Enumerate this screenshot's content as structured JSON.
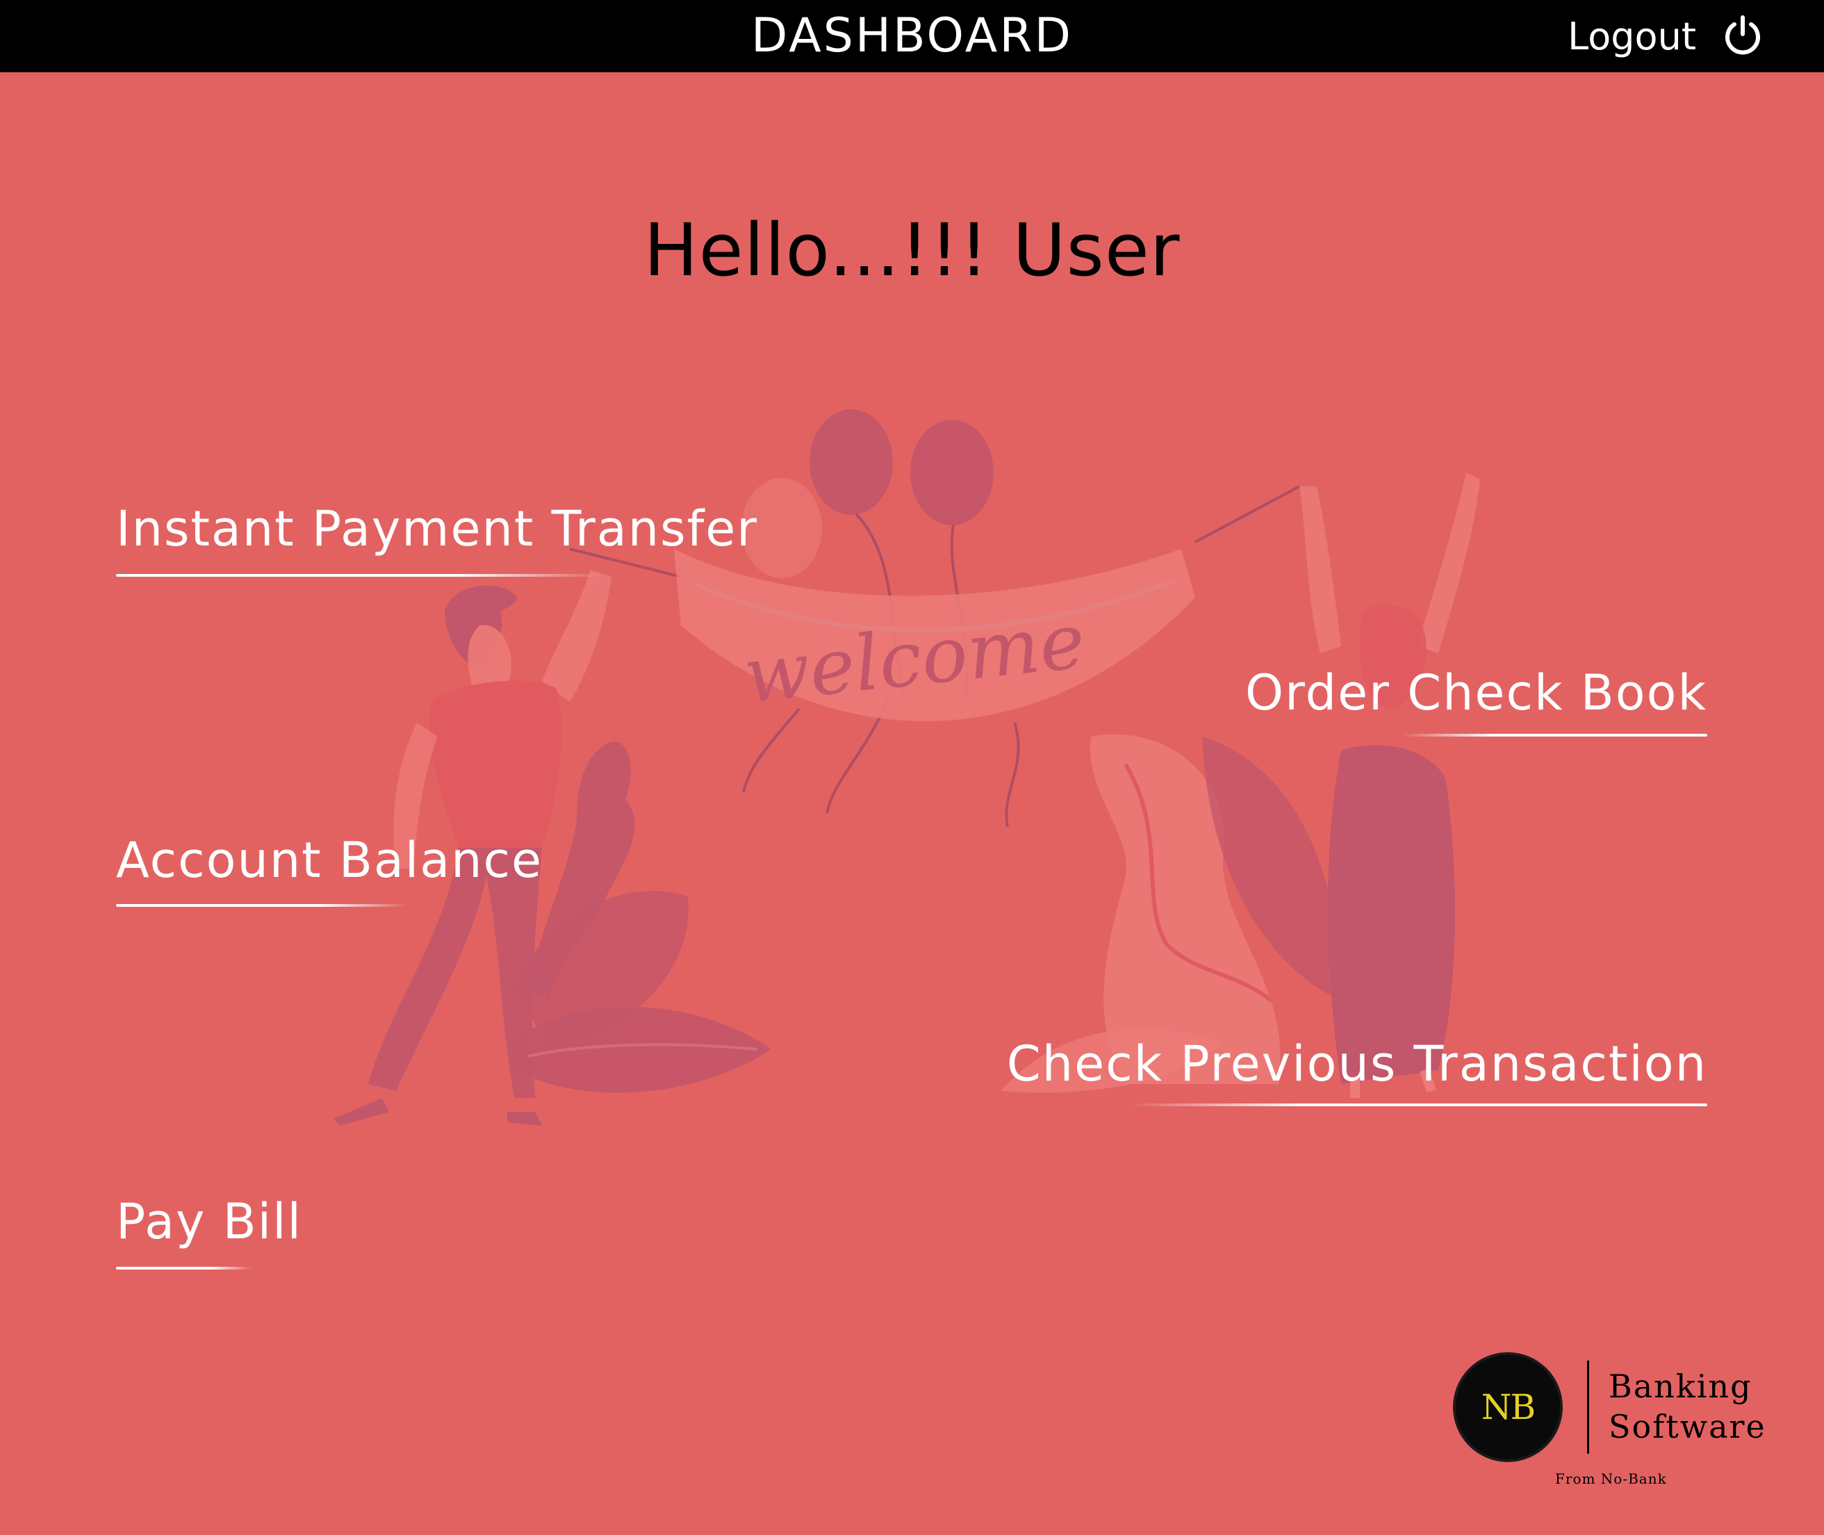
{
  "header": {
    "title": "DASHBOARD",
    "logout_label": "Logout",
    "logout_icon": "power-icon"
  },
  "greeting": "Hello...!!! User",
  "menu": {
    "instant_payment": "Instant Payment Transfer",
    "account_balance": "Account Balance",
    "pay_bill": "Pay Bill",
    "order_check_book": "Order Check Book",
    "check_previous_transaction": "Check Previous Transaction"
  },
  "illustration": {
    "banner_text": "welcome"
  },
  "brand": {
    "logo_text": "NB",
    "name_line1": "Banking",
    "name_line2": "Software",
    "tagline": "From No-Bank"
  },
  "colors": {
    "background": "#e26262",
    "topbar": "#000000",
    "link_text": "#ffffff",
    "logo_gold": "#e6cf2a",
    "illustration_dark": "#c2566a",
    "illustration_light": "#ec7b78"
  }
}
